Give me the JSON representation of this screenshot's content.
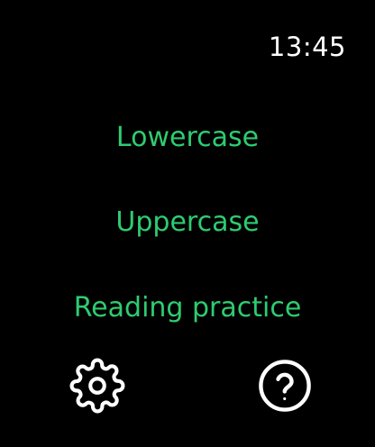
{
  "status_bar": {
    "time": "13:45"
  },
  "menu": {
    "items": [
      {
        "label": "Lowercase"
      },
      {
        "label": "Uppercase"
      },
      {
        "label": "Reading practice"
      }
    ]
  },
  "toolbar": {
    "settings_icon": "gear-icon",
    "help_icon": "question-mark-circle-icon"
  },
  "colors": {
    "background": "#000000",
    "accent": "#2ecc71",
    "clock": "#ffffff",
    "icons": "#ffffff"
  }
}
